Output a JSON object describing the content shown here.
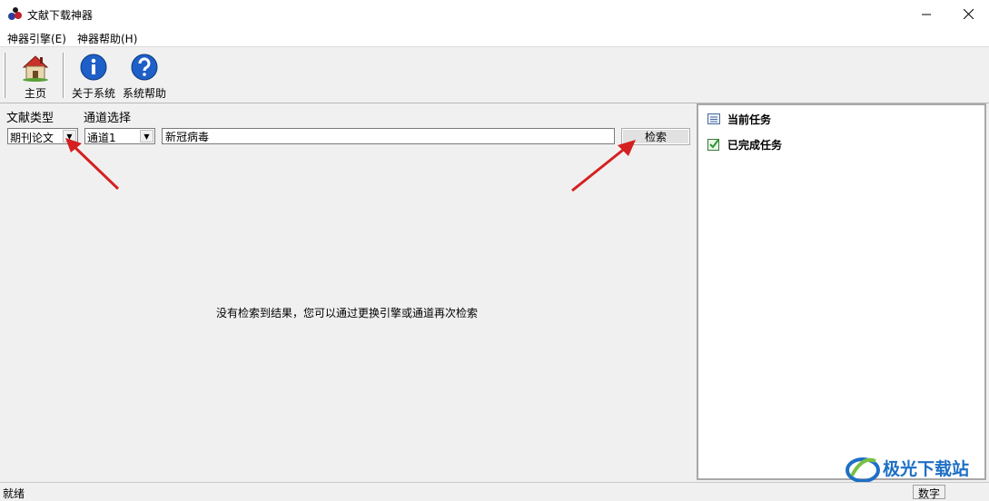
{
  "window": {
    "title": "文献下载神器"
  },
  "menu": [
    "神器引擎(E)",
    "神器帮助(H)"
  ],
  "toolbar": {
    "home": "主页",
    "about": "关于系统",
    "help": "系统帮助"
  },
  "form": {
    "type_label": "文献类型",
    "channel_label": "通道选择",
    "type_value": "期刊论文",
    "channel_value": "通道1",
    "search_value": "新冠病毒",
    "search_button": "检索"
  },
  "results": {
    "empty_message": "没有检索到结果，您可以通过更换引擎或通道再次检索"
  },
  "tasks": {
    "current": "当前任务",
    "completed": "已完成任务"
  },
  "status": {
    "text": "就绪",
    "num": "数字"
  },
  "watermark": {
    "text": "极光下载站"
  },
  "colors": {
    "accent_red": "#d42020",
    "watermark_blue": "#1e6fc5"
  }
}
